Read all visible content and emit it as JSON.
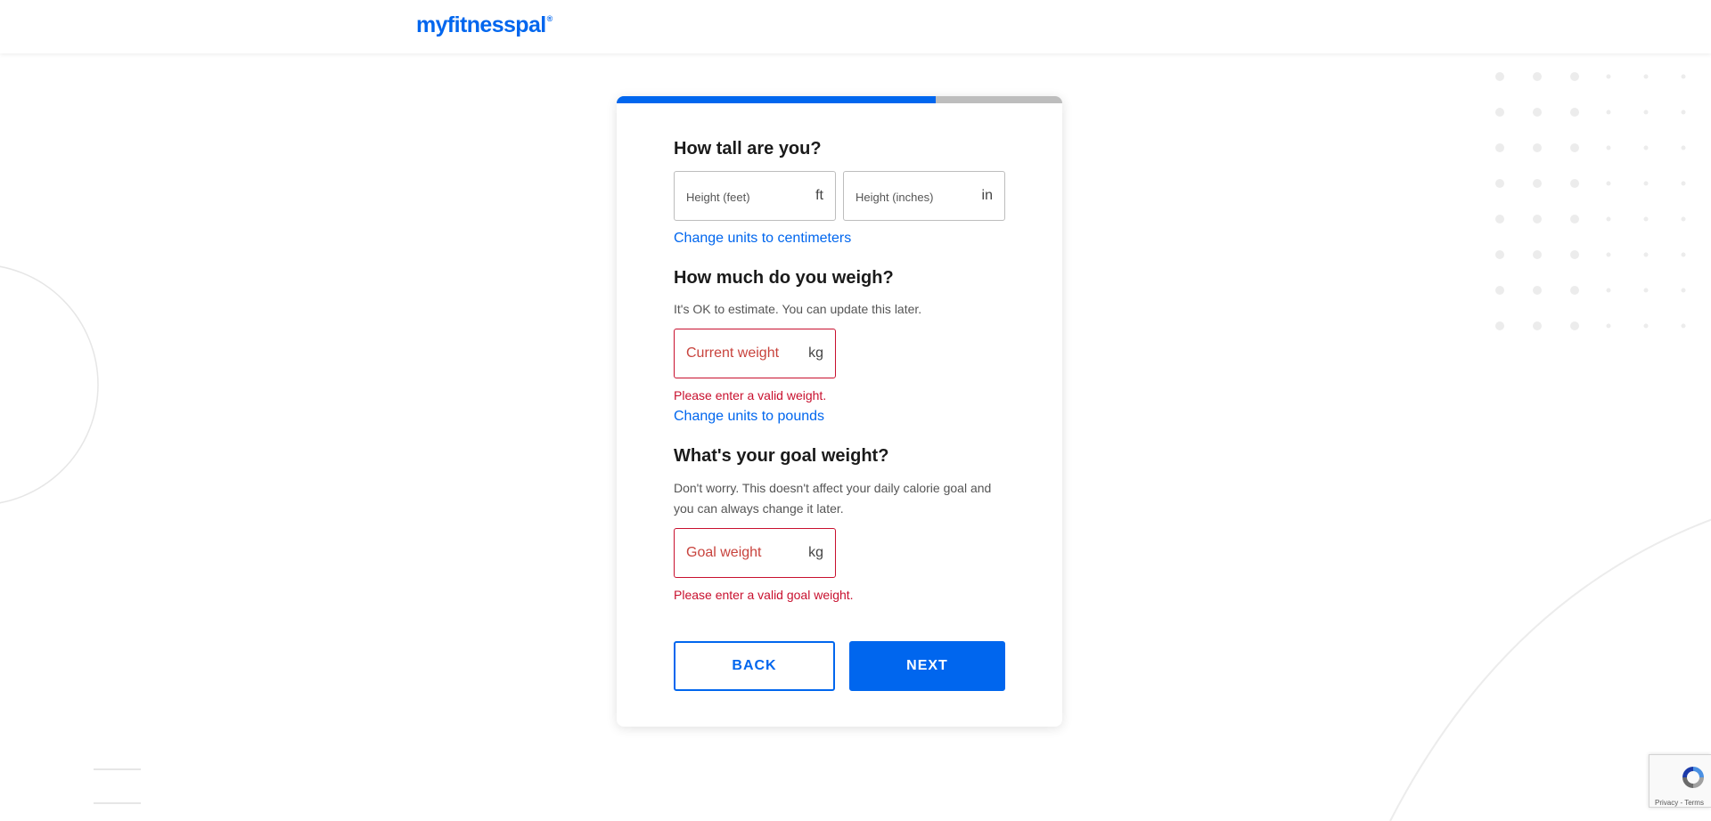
{
  "header": {
    "logo_text": "myfitnesspal",
    "logo_mark": "®"
  },
  "progress": {
    "fraction": 0.715
  },
  "height": {
    "title": "How tall are you?",
    "feet_placeholder": "Height (feet)",
    "feet_unit": "ft",
    "inches_placeholder": "Height (inches)",
    "inches_unit": "in",
    "change_units": "Change units to centimeters"
  },
  "weight": {
    "title": "How much do you weigh?",
    "hint": "It's OK to estimate. You can update this later.",
    "placeholder": "Current weight",
    "unit": "kg",
    "error": "Please enter a valid weight.",
    "change_units": "Change units to pounds"
  },
  "goal": {
    "title": "What's your goal weight?",
    "hint": "Don't worry. This doesn't affect your daily calorie goal and you can always change it later.",
    "placeholder": "Goal weight",
    "unit": "kg",
    "error": "Please enter a valid goal weight."
  },
  "buttons": {
    "back": "BACK",
    "next": "NEXT"
  },
  "recaptcha": {
    "links": "Privacy - Terms"
  },
  "colors": {
    "accent": "#0066ee",
    "error": "#c8102e",
    "track": "#bdbdbd"
  }
}
